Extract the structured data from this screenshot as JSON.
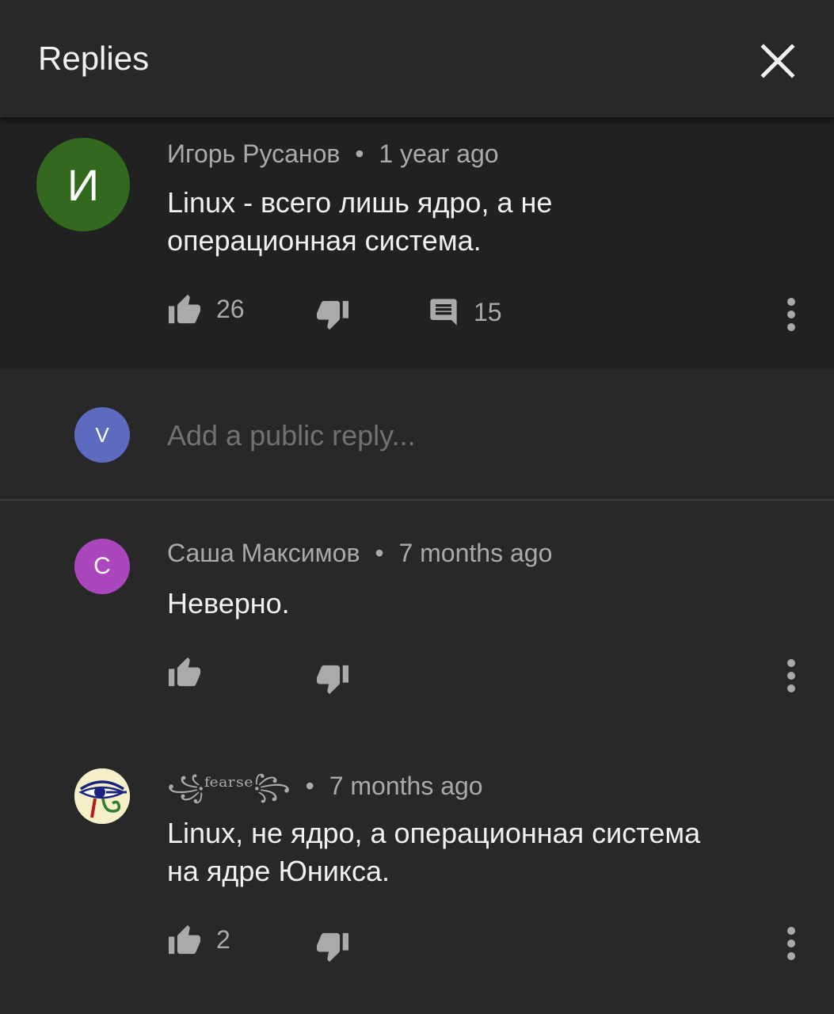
{
  "header": {
    "title": "Replies",
    "close_icon": "close-icon"
  },
  "parent_comment": {
    "avatar_letter": "И",
    "avatar_color": "#33691e",
    "author": "Игорь Русанов",
    "time": "1 year ago",
    "text_line1": "Linux - всего лишь ядро, а не",
    "text_line2": "операционная система.",
    "likes": "26",
    "replies": "15"
  },
  "reply_box": {
    "avatar_letter": "V",
    "avatar_color": "#5c6bc0",
    "placeholder": "Add a public reply..."
  },
  "replies": [
    {
      "avatar_letter": "С",
      "avatar_color": "#ab47bc",
      "author": "Саша Максимов",
      "time": "7 months ago",
      "text_line1": "Неверно.",
      "likes": ""
    },
    {
      "avatar_icon": "eye-of-horus-avatar",
      "author": "꧁ᶠᵉᵃʳˢᵉ꧂",
      "time": "7 months ago",
      "text_line1": "Linux, не ядро, а операционная система",
      "text_line2": "на ядре Юникса.",
      "likes": "2"
    }
  ],
  "separator": "•",
  "colors": {
    "background": "#282828",
    "highlight": "#212121",
    "text": "#f1f1f1",
    "secondary": "#aaaaaa"
  }
}
